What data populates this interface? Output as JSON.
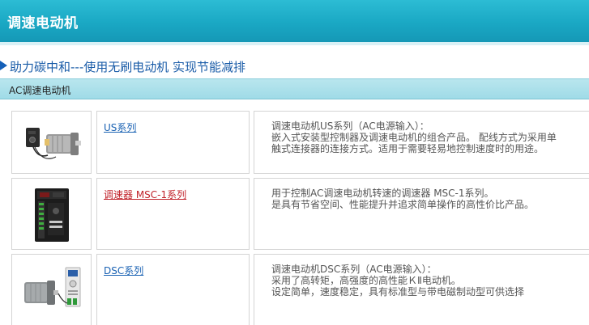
{
  "header": {
    "title": "调速电动机"
  },
  "banner": {
    "text": "助力碳中和---使用无刷电动机 实现节能减排"
  },
  "section": {
    "title": "AC调速电动机"
  },
  "products": [
    {
      "name": "US系列",
      "desc": [
        "调速电动机US系列（AC电源输入）：",
        "嵌入式安装型控制器及调速电动机的组合产品。 配线方式为采用单",
        "触式连接器的连接方式。适用于需要轻易地控制速度时的用途。"
      ],
      "image": "motor-with-speed-controller-icon"
    },
    {
      "name": "调速器 MSC-1系列",
      "desc": [
        "用于控制AC调速电动机转速的调速器 MSC-1系列。",
        "是具有节省空间、性能提升并追求简单操作的高性价比产品。"
      ],
      "image": "speed-controller-unit-icon",
      "link_color": "#c0222a"
    },
    {
      "name": "DSC系列",
      "desc": [
        "调速电动机DSC系列（AC电源输入）：",
        "采用了高转矩，高强度的高性能ＫⅡ电动机。",
        "设定简单，速度稳定，具有标准型与带电磁制动型可供选择"
      ],
      "image": "gear-motor-with-controller-icon"
    }
  ],
  "colors": {
    "header": "#1aa8c4",
    "link": "#1a62b3",
    "link_red": "#c0222a",
    "section_bar": "#a8dfe9"
  }
}
